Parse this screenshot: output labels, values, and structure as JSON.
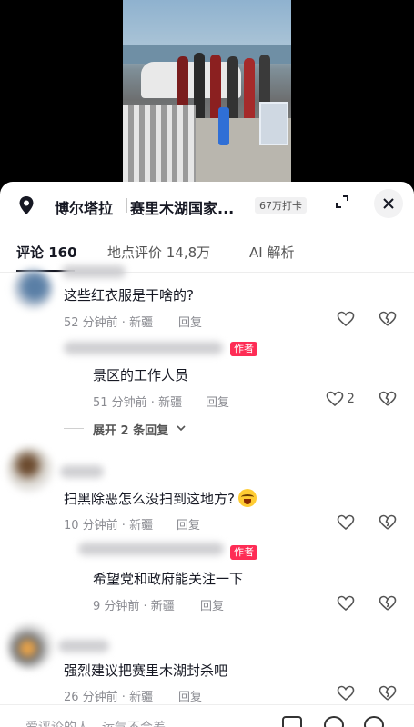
{
  "location": {
    "name": "博尔塔拉",
    "detail": "赛里木湖国家...",
    "checkin": "67万打卡"
  },
  "tabs": [
    {
      "label": "评论 160"
    },
    {
      "label": "地点评价 14,8万"
    },
    {
      "label": "AI 解析"
    }
  ],
  "comments": [
    {
      "text": "这些红衣服是干啥的?",
      "meta": "52 分钟前 · 新疆",
      "reply": "回复",
      "likes": ""
    },
    {
      "text": "景区的工作人员",
      "meta": "51 分钟前 · 新疆",
      "reply": "回复",
      "likes": "2",
      "author_tag": "作者"
    },
    {
      "expand": "展开 2 条回复"
    },
    {
      "text": "扫黑除恶怎么没扫到这地方?",
      "meta": "10 分钟前 · 新疆",
      "reply": "回复",
      "likes": ""
    },
    {
      "text": "希望党和政府能关注一下",
      "meta": "9 分钟前 · 新疆",
      "reply": "回复",
      "likes": "",
      "author_tag": "作者"
    },
    {
      "text": "强烈建议把赛里木湖封杀吧",
      "meta": "26 分钟前 · 新疆",
      "reply": "回复",
      "likes": ""
    }
  ],
  "input": {
    "placeholder": "爱评论的人，运气不会差"
  },
  "colors": {
    "accent": "#fe2c55",
    "text": "#161823",
    "meta": "#8a8b91"
  }
}
